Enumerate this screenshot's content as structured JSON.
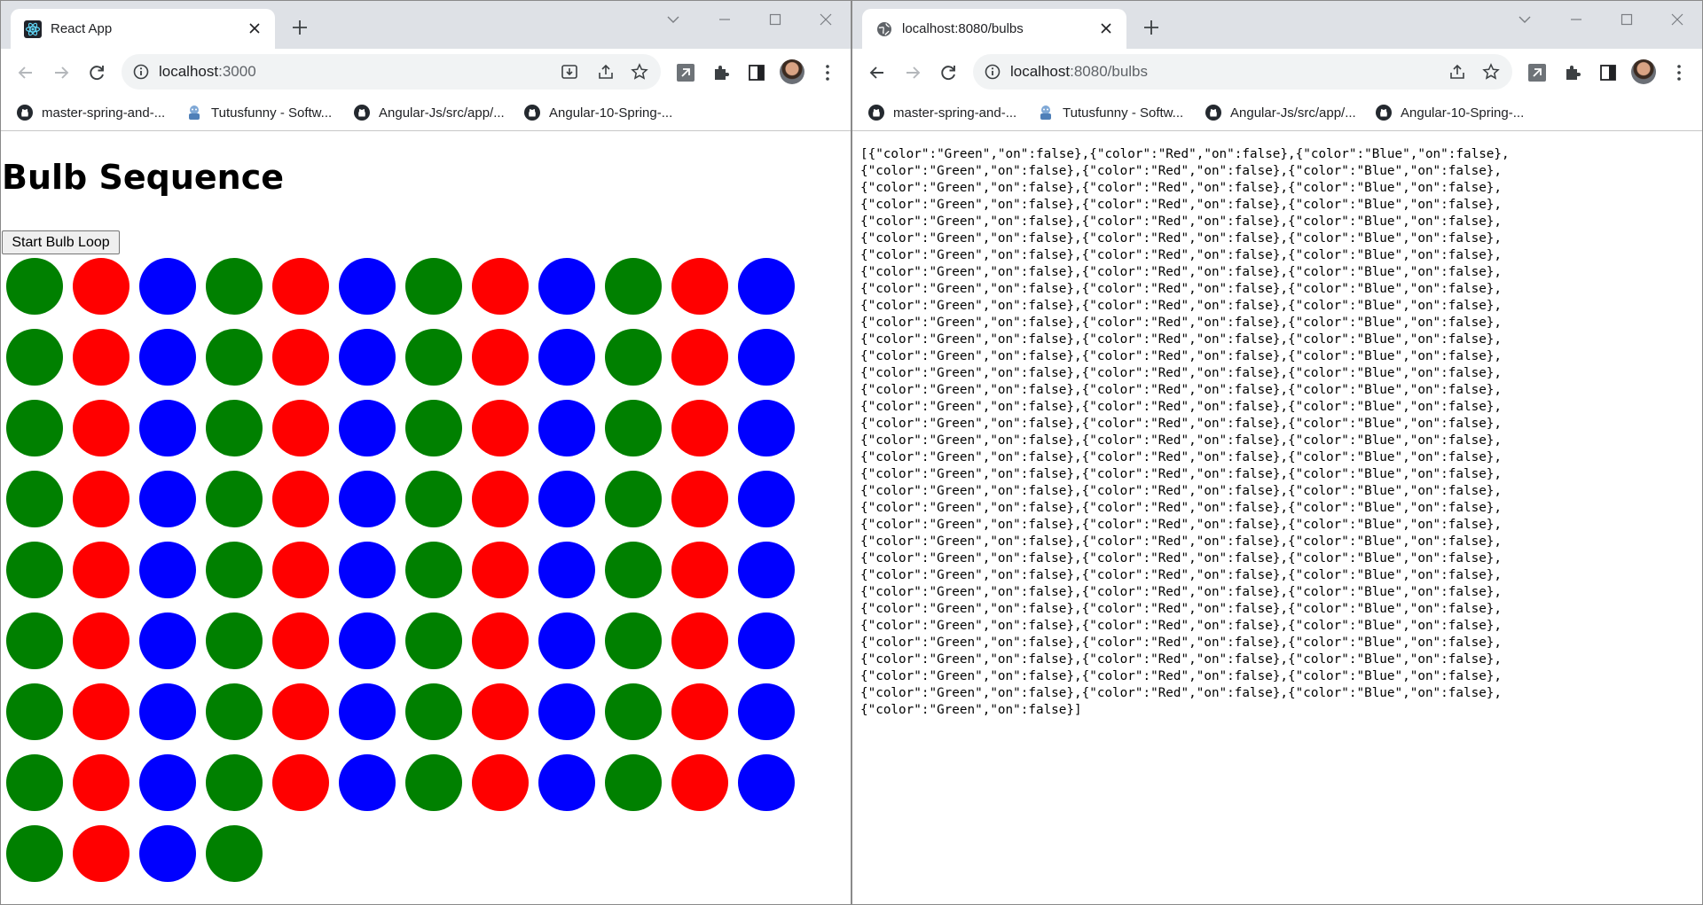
{
  "left_window": {
    "tab": {
      "title": "React App",
      "favicon": "react-icon"
    },
    "address": {
      "url": "localhost:3000",
      "host": "localhost",
      "rest": ":3000"
    },
    "page": {
      "heading": "Bulb Sequence",
      "button_label": "Start Bulb Loop",
      "bulb_columns": 12,
      "bulb_colors": {
        "Green": "#008000",
        "Red": "#ff0000",
        "Blue": "#0000ff"
      },
      "bulbs": [
        "Green",
        "Red",
        "Blue",
        "Green",
        "Red",
        "Blue",
        "Green",
        "Red",
        "Blue",
        "Green",
        "Red",
        "Blue",
        "Green",
        "Red",
        "Blue",
        "Green",
        "Red",
        "Blue",
        "Green",
        "Red",
        "Blue",
        "Green",
        "Red",
        "Blue",
        "Green",
        "Red",
        "Blue",
        "Green",
        "Red",
        "Blue",
        "Green",
        "Red",
        "Blue",
        "Green",
        "Red",
        "Blue",
        "Green",
        "Red",
        "Blue",
        "Green",
        "Red",
        "Blue",
        "Green",
        "Red",
        "Blue",
        "Green",
        "Red",
        "Blue",
        "Green",
        "Red",
        "Blue",
        "Green",
        "Red",
        "Blue",
        "Green",
        "Red",
        "Blue",
        "Green",
        "Red",
        "Blue",
        "Green",
        "Red",
        "Blue",
        "Green",
        "Red",
        "Blue",
        "Green",
        "Red",
        "Blue",
        "Green",
        "Red",
        "Blue",
        "Green",
        "Red",
        "Blue",
        "Green",
        "Red",
        "Blue",
        "Green",
        "Red",
        "Blue",
        "Green",
        "Red",
        "Blue",
        "Green",
        "Red",
        "Blue",
        "Green",
        "Red",
        "Blue",
        "Green",
        "Red",
        "Blue",
        "Green",
        "Red",
        "Blue",
        "Green",
        "Red",
        "Blue",
        "Green"
      ]
    }
  },
  "right_window": {
    "tab": {
      "title": "localhost:8080/bulbs",
      "favicon": "globe-icon"
    },
    "address": {
      "url": "localhost:8080/bulbs",
      "host": "localhost",
      "rest": ":8080/bulbs"
    },
    "json_lines": [
      "[{\"color\":\"Green\",\"on\":false},{\"color\":\"Red\",\"on\":false},{\"color\":\"Blue\",\"on\":false},",
      "{\"color\":\"Green\",\"on\":false},{\"color\":\"Red\",\"on\":false},{\"color\":\"Blue\",\"on\":false},",
      "{\"color\":\"Green\",\"on\":false},{\"color\":\"Red\",\"on\":false},{\"color\":\"Blue\",\"on\":false},",
      "{\"color\":\"Green\",\"on\":false},{\"color\":\"Red\",\"on\":false},{\"color\":\"Blue\",\"on\":false},",
      "{\"color\":\"Green\",\"on\":false},{\"color\":\"Red\",\"on\":false},{\"color\":\"Blue\",\"on\":false},",
      "{\"color\":\"Green\",\"on\":false},{\"color\":\"Red\",\"on\":false},{\"color\":\"Blue\",\"on\":false},",
      "{\"color\":\"Green\",\"on\":false},{\"color\":\"Red\",\"on\":false},{\"color\":\"Blue\",\"on\":false},",
      "{\"color\":\"Green\",\"on\":false},{\"color\":\"Red\",\"on\":false},{\"color\":\"Blue\",\"on\":false},",
      "{\"color\":\"Green\",\"on\":false},{\"color\":\"Red\",\"on\":false},{\"color\":\"Blue\",\"on\":false},",
      "{\"color\":\"Green\",\"on\":false},{\"color\":\"Red\",\"on\":false},{\"color\":\"Blue\",\"on\":false},",
      "{\"color\":\"Green\",\"on\":false},{\"color\":\"Red\",\"on\":false},{\"color\":\"Blue\",\"on\":false},",
      "{\"color\":\"Green\",\"on\":false},{\"color\":\"Red\",\"on\":false},{\"color\":\"Blue\",\"on\":false},",
      "{\"color\":\"Green\",\"on\":false},{\"color\":\"Red\",\"on\":false},{\"color\":\"Blue\",\"on\":false},",
      "{\"color\":\"Green\",\"on\":false},{\"color\":\"Red\",\"on\":false},{\"color\":\"Blue\",\"on\":false},",
      "{\"color\":\"Green\",\"on\":false},{\"color\":\"Red\",\"on\":false},{\"color\":\"Blue\",\"on\":false},",
      "{\"color\":\"Green\",\"on\":false},{\"color\":\"Red\",\"on\":false},{\"color\":\"Blue\",\"on\":false},",
      "{\"color\":\"Green\",\"on\":false},{\"color\":\"Red\",\"on\":false},{\"color\":\"Blue\",\"on\":false},",
      "{\"color\":\"Green\",\"on\":false},{\"color\":\"Red\",\"on\":false},{\"color\":\"Blue\",\"on\":false},",
      "{\"color\":\"Green\",\"on\":false},{\"color\":\"Red\",\"on\":false},{\"color\":\"Blue\",\"on\":false},",
      "{\"color\":\"Green\",\"on\":false},{\"color\":\"Red\",\"on\":false},{\"color\":\"Blue\",\"on\":false},",
      "{\"color\":\"Green\",\"on\":false},{\"color\":\"Red\",\"on\":false},{\"color\":\"Blue\",\"on\":false},",
      "{\"color\":\"Green\",\"on\":false},{\"color\":\"Red\",\"on\":false},{\"color\":\"Blue\",\"on\":false},",
      "{\"color\":\"Green\",\"on\":false},{\"color\":\"Red\",\"on\":false},{\"color\":\"Blue\",\"on\":false},",
      "{\"color\":\"Green\",\"on\":false},{\"color\":\"Red\",\"on\":false},{\"color\":\"Blue\",\"on\":false},",
      "{\"color\":\"Green\",\"on\":false},{\"color\":\"Red\",\"on\":false},{\"color\":\"Blue\",\"on\":false},",
      "{\"color\":\"Green\",\"on\":false},{\"color\":\"Red\",\"on\":false},{\"color\":\"Blue\",\"on\":false},",
      "{\"color\":\"Green\",\"on\":false},{\"color\":\"Red\",\"on\":false},{\"color\":\"Blue\",\"on\":false},",
      "{\"color\":\"Green\",\"on\":false},{\"color\":\"Red\",\"on\":false},{\"color\":\"Blue\",\"on\":false},",
      "{\"color\":\"Green\",\"on\":false},{\"color\":\"Red\",\"on\":false},{\"color\":\"Blue\",\"on\":false},",
      "{\"color\":\"Green\",\"on\":false},{\"color\":\"Red\",\"on\":false},{\"color\":\"Blue\",\"on\":false},",
      "{\"color\":\"Green\",\"on\":false},{\"color\":\"Red\",\"on\":false},{\"color\":\"Blue\",\"on\":false},",
      "{\"color\":\"Green\",\"on\":false},{\"color\":\"Red\",\"on\":false},{\"color\":\"Blue\",\"on\":false},",
      "{\"color\":\"Green\",\"on\":false},{\"color\":\"Red\",\"on\":false},{\"color\":\"Blue\",\"on\":false},",
      "{\"color\":\"Green\",\"on\":false}]"
    ]
  },
  "bookmarks": [
    {
      "label": "master-spring-and-...",
      "icon": "github-icon"
    },
    {
      "label": "Tutusfunny - Softw...",
      "icon": "tutusfunny-icon"
    },
    {
      "label": "Angular-Js/src/app/...",
      "icon": "github-icon"
    },
    {
      "label": "Angular-10-Spring-...",
      "icon": "github-icon"
    }
  ],
  "theme": {
    "tabstrip_bg": "#dee1e6",
    "omnibox_bg": "#f1f3f4",
    "icon_color": "#5f6368"
  }
}
